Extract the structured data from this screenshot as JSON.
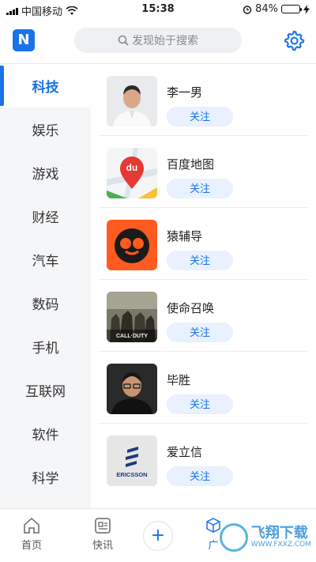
{
  "status_bar": {
    "carrier": "中国移动",
    "time": "15:38",
    "battery": "84%",
    "battery_level": 0.84
  },
  "header": {
    "logo_text": "N",
    "search_placeholder": "发现始于搜索",
    "settings_icon": "gear-icon"
  },
  "sidebar": {
    "items": [
      {
        "label": "科技"
      },
      {
        "label": "娱乐"
      },
      {
        "label": "游戏"
      },
      {
        "label": "财经"
      },
      {
        "label": "汽车"
      },
      {
        "label": "数码"
      },
      {
        "label": "手机"
      },
      {
        "label": "互联网"
      },
      {
        "label": "软件"
      },
      {
        "label": "科学"
      }
    ]
  },
  "list": {
    "items": [
      {
        "name": "李一男",
        "follow_label": "关注"
      },
      {
        "name": "百度地图",
        "follow_label": "关注"
      },
      {
        "name": "猿辅导",
        "follow_label": "关注"
      },
      {
        "name": "使命召唤",
        "follow_label": "关注"
      },
      {
        "name": "毕胜",
        "follow_label": "关注"
      },
      {
        "name": "爱立信",
        "follow_label": "关注"
      }
    ]
  },
  "thumbs": {
    "baidu": "du",
    "cod": "CALL·DUTY",
    "ericsson": "ERICSSON"
  },
  "bottom_nav": {
    "home": "首页",
    "news": "快讯",
    "plus": "+",
    "third": "广",
    "watermark_title": "飞翔下载",
    "watermark_url": "WWW.FXXZ.COM"
  },
  "colors": {
    "accent": "#1a73e8",
    "follow_bg": "#e8f1fd",
    "sidebar_bg": "#f5f6f8"
  }
}
